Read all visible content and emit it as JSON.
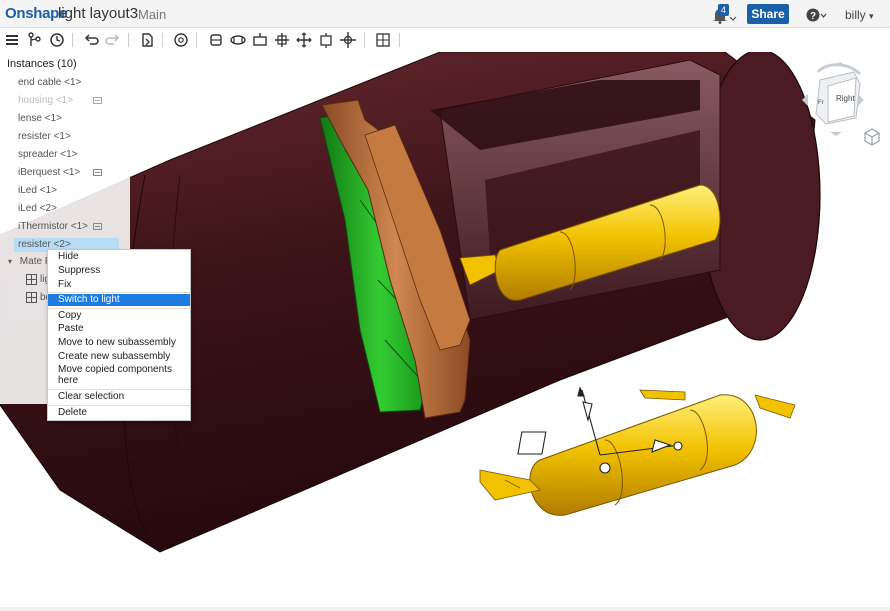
{
  "header": {
    "logo": "Onshape",
    "document_name": "light layout3",
    "workspace": "Main",
    "notification_count": "4",
    "share_label": "Share",
    "user": "billy",
    "caret": "▾"
  },
  "toolbar": {
    "icons": [
      "menu-icon",
      "feature-tree-icon",
      "history-icon",
      "undo-icon",
      "redo-icon",
      "insert-icon",
      "mate-connector-icon",
      "fastened-mate-icon",
      "revolute-mate-icon",
      "slider-mate-icon",
      "planar-mate-icon",
      "cylindrical-mate-icon",
      "pin-slot-mate-icon",
      "ball-mate-icon",
      "explode-icon"
    ]
  },
  "instances_panel": {
    "title": "Instances (10)",
    "items": [
      {
        "label": "end cable <1>",
        "state": "normal"
      },
      {
        "label": "housing <1>",
        "state": "hidden"
      },
      {
        "label": "lense <1>",
        "state": "normal"
      },
      {
        "label": "resister <1>",
        "state": "normal"
      },
      {
        "label": "spreader <1>",
        "state": "normal"
      },
      {
        "label": "iBerquest <1>",
        "state": "normal"
      },
      {
        "label": "iLed <1>",
        "state": "normal"
      },
      {
        "label": "iLed <2>",
        "state": "normal"
      },
      {
        "label": "iThermistor <1>",
        "state": "normal"
      },
      {
        "label": "resister <2>",
        "state": "selected"
      }
    ],
    "mate_group": "Mate F",
    "mate_items": [
      "lig",
      "bo"
    ]
  },
  "context_menu": {
    "items": [
      {
        "label": "Hide"
      },
      {
        "label": "Suppress"
      },
      {
        "label": "Fix"
      },
      {
        "label": "Switch to light",
        "highlighted": true
      },
      {
        "label": "Copy"
      },
      {
        "label": "Paste"
      },
      {
        "label": "Move to new subassembly"
      },
      {
        "label": "Create new subassembly"
      },
      {
        "label": "Move copied components here"
      },
      {
        "label": "Clear selection"
      },
      {
        "label": "Delete"
      }
    ]
  },
  "view_cube": {
    "face_right": "Right",
    "face_front": "Fr"
  },
  "colors": {
    "brand": "#1b5fa8",
    "housing": "#4a1a20",
    "green_ring": "#22aa22",
    "copper": "#b5683a",
    "gold": "#f2c200",
    "highlight": "#1e7be0",
    "selection": "#b8dcf5"
  }
}
